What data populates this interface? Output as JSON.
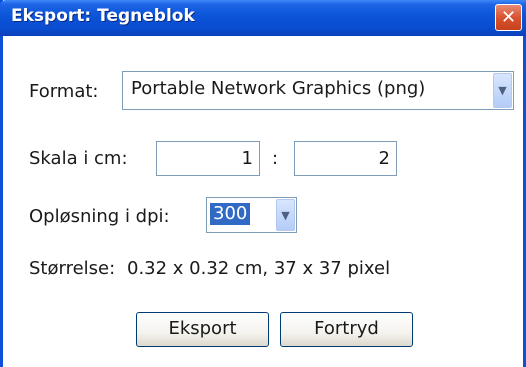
{
  "window": {
    "title": "Eksport: Tegneblok",
    "close_glyph": "✕"
  },
  "format": {
    "label": "Format:",
    "selected": "Portable Network Graphics (png)"
  },
  "scale": {
    "label": "Skala i cm:",
    "left_value": "1",
    "separator": ":",
    "right_value": "2"
  },
  "resolution": {
    "label": "Opløsning i dpi:",
    "selected": "300"
  },
  "size": {
    "label": "Størrelse:",
    "value": "0.32 x 0.32 cm, 37 x 37 pixel"
  },
  "buttons": {
    "export": "Eksport",
    "cancel": "Fortryd"
  },
  "icons": {
    "dropdown": "chevron-down-icon",
    "close": "close-icon"
  }
}
